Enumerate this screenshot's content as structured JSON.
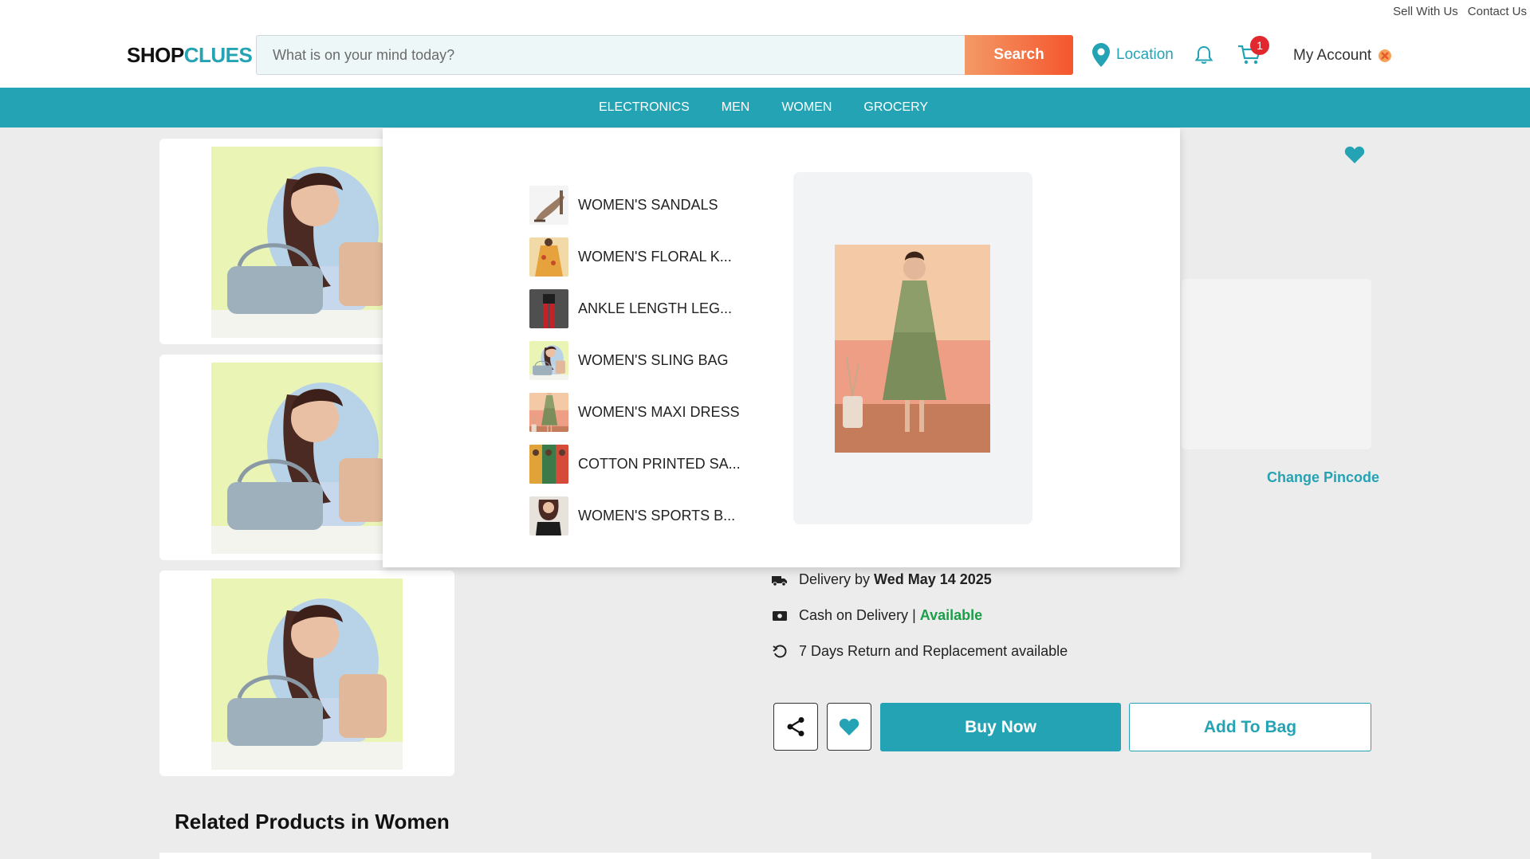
{
  "header": {
    "top_links": [
      "Sell With Us",
      "Contact Us"
    ],
    "logo": {
      "part1": "SHOP",
      "part2": "CLUES"
    },
    "search": {
      "placeholder": "What is on your mind today?",
      "button": "Search"
    },
    "location_label": "Location",
    "cart_count": "1",
    "account_label": "My Account"
  },
  "nav": {
    "items": [
      "ELECTRONICS",
      "MEN",
      "WOMEN",
      "GROCERY"
    ]
  },
  "dropdown": {
    "items": [
      {
        "label": "WOMEN'S SANDALS",
        "icon": "sandal-thumb"
      },
      {
        "label": "WOMEN'S FLORAL K...",
        "icon": "kurti-thumb"
      },
      {
        "label": "ANKLE LENGTH LEG...",
        "icon": "leggings-thumb"
      },
      {
        "label": "WOMEN'S SLING BAG",
        "icon": "sling-bag-thumb"
      },
      {
        "label": "WOMEN'S MAXI DRESS",
        "icon": "maxi-dress-thumb"
      },
      {
        "label": "COTTON PRINTED SA...",
        "icon": "saree-thumb"
      },
      {
        "label": "WOMEN'S SPORTS B...",
        "icon": "sports-bra-thumb"
      }
    ],
    "feature_image": "maxi-dress-photo"
  },
  "product": {
    "change_pincode": "Change Pincode",
    "delivery": {
      "prefix": "Delivery by",
      "date": "Wed May 14 2025"
    },
    "cod": {
      "prefix": "Cash on Delivery",
      "separator": "|",
      "status": "Available"
    },
    "returns": "7 Days Return and Replacement available",
    "buy_now": "Buy Now",
    "add_to_bag": "Add To Bag"
  },
  "related": {
    "title": "Related Products in Women"
  },
  "colors": {
    "accent": "#24a3b5",
    "search_gradient_start": "#f39a66",
    "search_gradient_end": "#f5562e",
    "badge": "#e0282e",
    "available": "#1a9e47"
  }
}
